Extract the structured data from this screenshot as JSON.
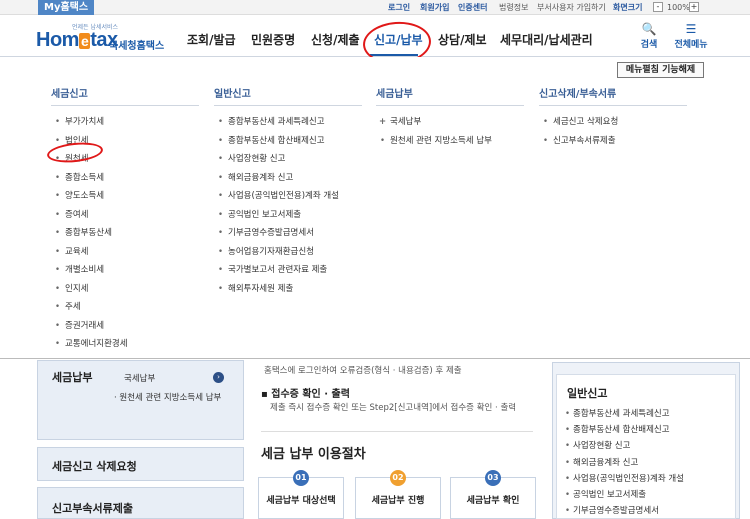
{
  "topbar": {
    "my_tab": "My홈택스",
    "links": [
      "로그인",
      "회원가입",
      "인증센터",
      "법령정보",
      "부서사용자 가입하기",
      "화면크기"
    ],
    "zoom_minus": "-",
    "zoom_level": "100%",
    "zoom_plus": "+"
  },
  "header": {
    "logo_sub": "언제든 납세서비스",
    "logo_text_a": "Hom",
    "logo_text_e": "e",
    "logo_text_b": "tax",
    "logo_tag": "국세청홈택스",
    "nav": [
      "조회/발급",
      "민원증명",
      "신청/제출",
      "신고/납부",
      "상담/제보",
      "세무대리/납세관리"
    ],
    "active_nav": "신고/납부",
    "search_label": "검색",
    "allmenu_label": "전체메뉴",
    "search_glyph": "🔍",
    "allmenu_glyph": "☰"
  },
  "mega": {
    "fix_button": "메뉴펼침 기능해제",
    "columns": [
      {
        "title": "세금신고",
        "items": [
          "부가가치세",
          "법인세",
          "원천세",
          "종합소득세",
          "양도소득세",
          "증여세",
          "종합부동산세",
          "교육세",
          "개별소비세",
          "인지세",
          "주세",
          "증권거래세",
          "교통에너지환경세"
        ]
      },
      {
        "title": "일반신고",
        "items": [
          "종합부동산세 과세특례신고",
          "종합부동산세 합산배제신고",
          "사업장현황 신고",
          "해외금융계좌 신고",
          "사업용(공익법인전용)계좌 개설",
          "공익법인 보고서제출",
          "기부금영수증발급명세서",
          "농어업용기자재환급신청",
          "국가별보고서 관련자료 제출",
          "해외투자세원 제출"
        ]
      },
      {
        "title": "세금납부",
        "items": [
          "국세납부",
          "원천세 관련 지방소득세 납부"
        ]
      },
      {
        "title": "신고삭제/부속서류",
        "items": [
          "세금신고 삭제요청",
          "신고부속서류제출"
        ]
      }
    ]
  },
  "background": {
    "left": {
      "tax_payment_title": "세금납부",
      "national_tax_payment": "국세납부",
      "local_income_tax": "· 원천세 관련 지방소득세 납부",
      "delete_request": "세금신고 삭제요청",
      "attach_docs": "신고부속서류제출"
    },
    "middle": {
      "line1": "홈택스에 로그인하여 오류검증(형식 · 내용검증) 후 제출",
      "head2": "▪ 접수증 확인 · 출력",
      "line2": "제출 즉시 접수증 확인 또는 Step2[신고내역]에서 접수증 확인 · 출력",
      "proc_title": "세금 납부 이용절차",
      "steps": [
        {
          "num": "01",
          "label": "세금납부 대상선택",
          "color": "#3a6fb8"
        },
        {
          "num": "02",
          "label": "세금납부 진행",
          "color": "#f0a030"
        },
        {
          "num": "03",
          "label": "세금납부 확인",
          "color": "#3a6fb8"
        }
      ]
    },
    "right": {
      "title": "일반신고",
      "items": [
        "종합부동산세 과세특례신고",
        "종합부동산세 합산배제신고",
        "사업장현황 신고",
        "해외금융계좌 신고",
        "사업용(공익법인전용)계좌 개설",
        "공익법인 보고서제출",
        "기부금영수증발급명세서"
      ]
    }
  },
  "colors": {
    "brand": "#1b5aa8",
    "accent_orange": "#f28c1c",
    "annotation_red": "#e01818"
  }
}
